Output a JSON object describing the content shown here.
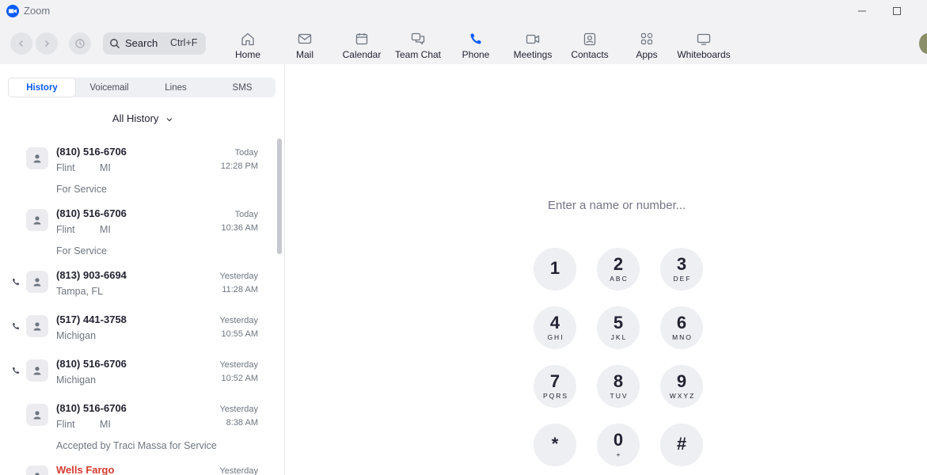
{
  "window": {
    "title": "Zoom"
  },
  "search": {
    "label": "Search",
    "shortcut": "Ctrl+F"
  },
  "nav_tabs": [
    {
      "label": "Home",
      "icon": "home-icon"
    },
    {
      "label": "Mail",
      "icon": "mail-icon"
    },
    {
      "label": "Calendar",
      "icon": "calendar-icon"
    },
    {
      "label": "Team Chat",
      "icon": "chat-icon"
    },
    {
      "label": "Phone",
      "icon": "phone-icon",
      "active": true
    },
    {
      "label": "Meetings",
      "icon": "video-icon"
    },
    {
      "label": "Contacts",
      "icon": "contacts-icon"
    },
    {
      "label": "Apps",
      "icon": "apps-icon"
    },
    {
      "label": "Whiteboards",
      "icon": "whiteboard-icon"
    }
  ],
  "phone_tabs": [
    {
      "label": "History",
      "active": true
    },
    {
      "label": "Voicemail"
    },
    {
      "label": "Lines"
    },
    {
      "label": "SMS"
    }
  ],
  "filter": {
    "label": "All History"
  },
  "history": [
    {
      "number": "(810) 516-6706",
      "location": "Flint",
      "state": "MI",
      "date": "Today",
      "time": "12:28 PM",
      "note": "For Service",
      "call_icon": false,
      "red": false
    },
    {
      "number": "(810) 516-6706",
      "location": "Flint",
      "state": "MI",
      "date": "Today",
      "time": "10:36 AM",
      "note": "For Service",
      "call_icon": false,
      "red": false
    },
    {
      "number": "(813) 903-6694",
      "location": "Tampa, FL",
      "state": "",
      "date": "Yesterday",
      "time": "11:28 AM",
      "note": "",
      "call_icon": true,
      "red": false
    },
    {
      "number": "(517) 441-3758",
      "location": "Michigan",
      "state": "",
      "date": "Yesterday",
      "time": "10:55 AM",
      "note": "",
      "call_icon": true,
      "red": false
    },
    {
      "number": "(810) 516-6706",
      "location": "Michigan",
      "state": "",
      "date": "Yesterday",
      "time": "10:52 AM",
      "note": "",
      "call_icon": true,
      "red": false
    },
    {
      "number": "(810) 516-6706",
      "location": "Flint",
      "state": "MI",
      "date": "Yesterday",
      "time": "8:38 AM",
      "note": "Accepted by Traci Massa for Service",
      "call_icon": false,
      "red": false
    },
    {
      "number": "Wells Fargo",
      "location": "",
      "state": "",
      "date": "Yesterday",
      "time": "",
      "note": "",
      "call_icon": false,
      "red": true
    }
  ],
  "dialer": {
    "placeholder": "Enter a name or number...",
    "keys": [
      {
        "digit": "1",
        "letters": ""
      },
      {
        "digit": "2",
        "letters": "ABC"
      },
      {
        "digit": "3",
        "letters": "DEF"
      },
      {
        "digit": "4",
        "letters": "GHI"
      },
      {
        "digit": "5",
        "letters": "JKL"
      },
      {
        "digit": "6",
        "letters": "MNO"
      },
      {
        "digit": "7",
        "letters": "PQRS"
      },
      {
        "digit": "8",
        "letters": "TUV"
      },
      {
        "digit": "9",
        "letters": "WXYZ"
      },
      {
        "digit": "*",
        "letters": ""
      },
      {
        "digit": "0",
        "letters": "+"
      },
      {
        "digit": "#",
        "letters": ""
      }
    ]
  },
  "colors": {
    "accent": "#0b5cff",
    "danger": "#d93a2f"
  }
}
